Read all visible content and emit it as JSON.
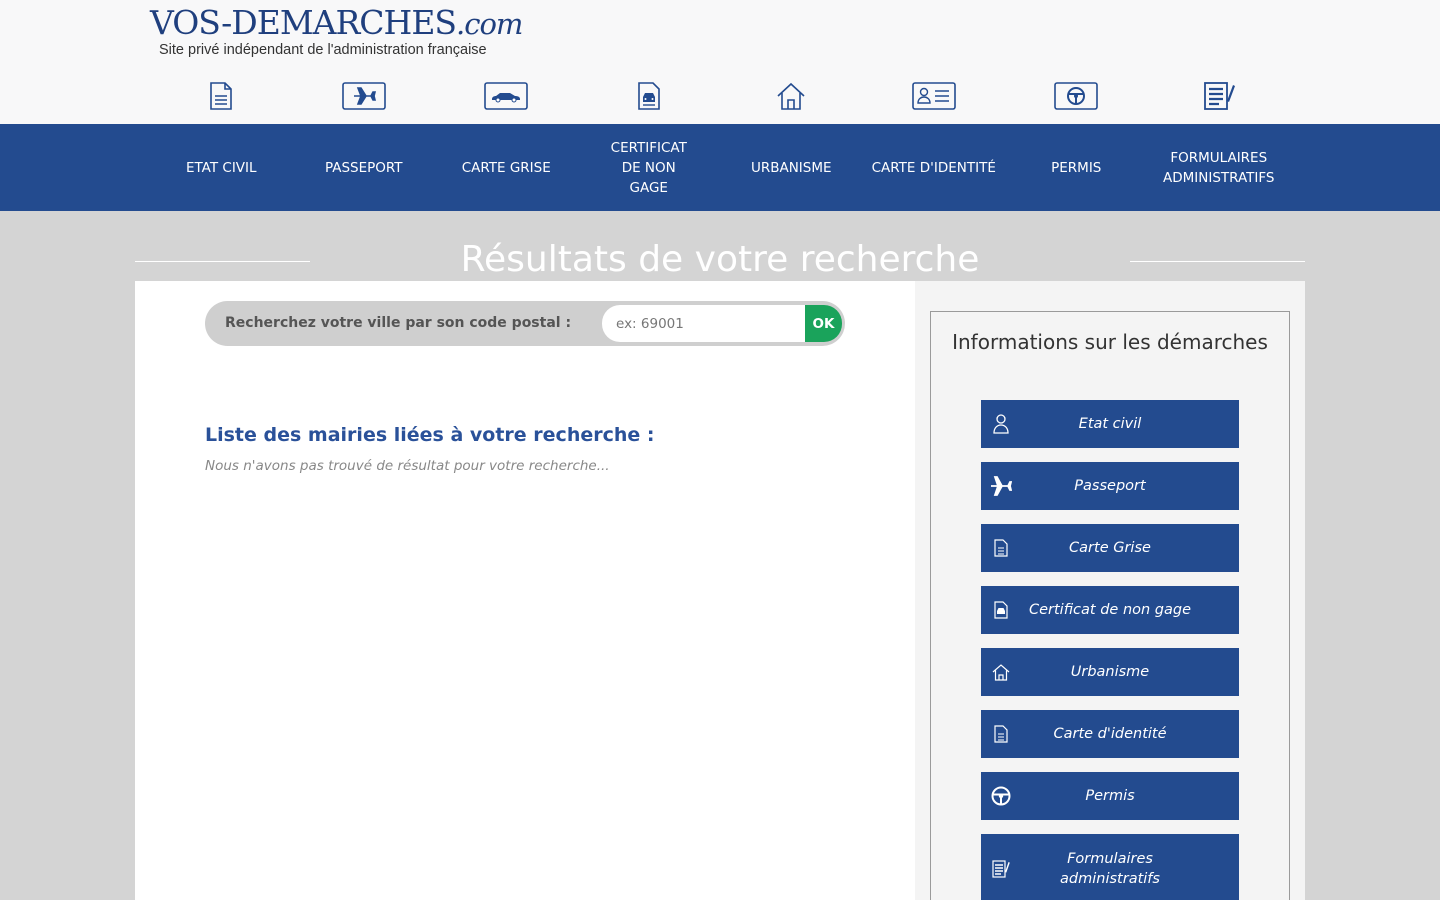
{
  "logo": {
    "brand": "VOS-DEMARCHES",
    "tld": ".com",
    "tagline": "Site privé indépendant de l'administration française"
  },
  "icons": [
    "document-icon",
    "airplane-icon",
    "car-icon",
    "vehicle-document-icon",
    "house-icon",
    "id-card-icon",
    "steering-wheel-icon",
    "forms-icon"
  ],
  "nav": {
    "items": [
      {
        "label": "ETAT CIVIL"
      },
      {
        "label": "PASSEPORT"
      },
      {
        "label": "CARTE GRISE"
      },
      {
        "label": "CERTIFICAT DE NON GAGE"
      },
      {
        "label": "URBANISME"
      },
      {
        "label": "CARTE D'IDENTITÉ"
      },
      {
        "label": "PERMIS"
      },
      {
        "label": "FORMULAIRES ADMINISTRATIFS"
      }
    ]
  },
  "page": {
    "title": "Résultats de votre recherche"
  },
  "search": {
    "label": "Recherchez votre ville par son code postal :",
    "placeholder": "ex: 69001",
    "value": "",
    "button": "OK"
  },
  "results": {
    "heading": "Liste des mairies liées à votre recherche :",
    "empty_message": "Nous n'avons pas trouvé de résultat pour votre recherche..."
  },
  "sidebar": {
    "title": "Informations sur les démarches",
    "items": [
      {
        "label": "Etat civil",
        "icon": "person-icon"
      },
      {
        "label": "Passeport",
        "icon": "airplane-icon"
      },
      {
        "label": "Carte Grise",
        "icon": "document-icon"
      },
      {
        "label": "Certificat de non gage",
        "icon": "vehicle-document-icon"
      },
      {
        "label": "Urbanisme",
        "icon": "house-icon"
      },
      {
        "label": "Carte d'identité",
        "icon": "document-icon"
      },
      {
        "label": "Permis",
        "icon": "steering-wheel-icon"
      },
      {
        "label": "Formulaires administratifs",
        "icon": "forms-icon"
      }
    ]
  },
  "colors": {
    "brand_blue": "#234b8f",
    "heading_blue": "#2a5199",
    "ok_green": "#1aa35b",
    "background_gray": "#d4d4d4"
  }
}
